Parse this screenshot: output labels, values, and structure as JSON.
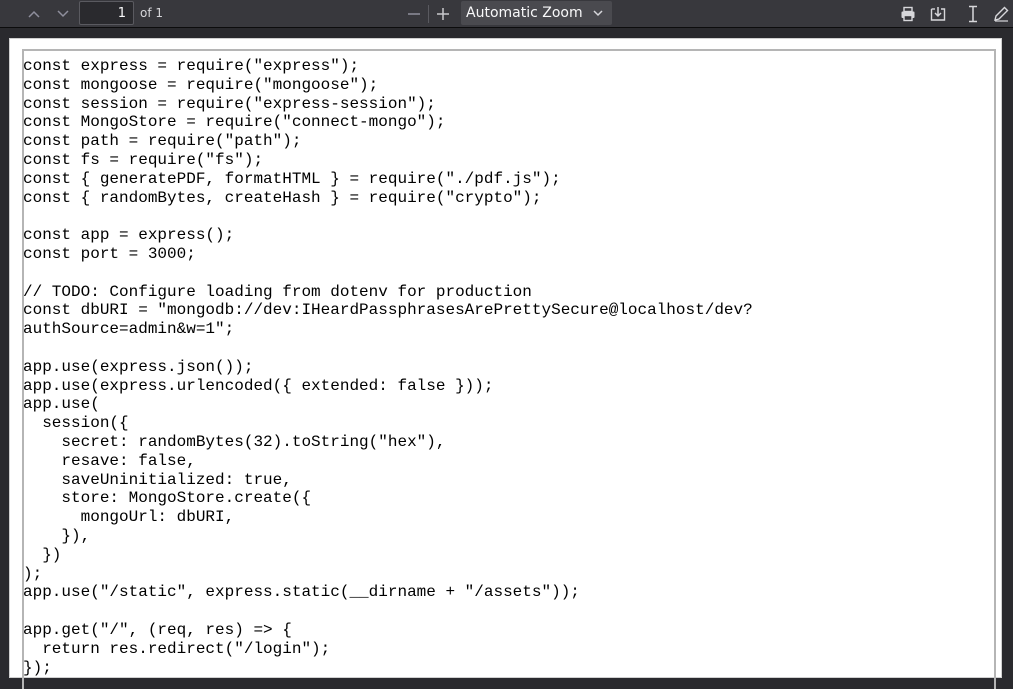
{
  "toolbar": {
    "page_number": "1",
    "page_count": "of 1",
    "zoom_value": "Automatic Zoom"
  },
  "icons": {
    "previous_page": "chevron-up-icon",
    "next_page": "chevron-down-icon",
    "zoom_out": "minus-icon",
    "zoom_in": "plus-icon",
    "zoom_dropdown": "chevron-down-icon",
    "print": "printer-icon",
    "save": "download-icon",
    "text_select": "text-cursor-icon",
    "draw": "pencil-icon"
  },
  "colors": {
    "toolbar_bg": "#38383d",
    "viewer_bg": "#2a2a2e",
    "page_bg": "#ffffff"
  },
  "document": {
    "lines": [
      "const express = require(\"express\");",
      "const mongoose = require(\"mongoose\");",
      "const session = require(\"express-session\");",
      "const MongoStore = require(\"connect-mongo\");",
      "const path = require(\"path\");",
      "const fs = require(\"fs\");",
      "const { generatePDF, formatHTML } = require(\"./pdf.js\");",
      "const { randomBytes, createHash } = require(\"crypto\");",
      "",
      "const app = express();",
      "const port = 3000;",
      "",
      "// TODO: Configure loading from dotenv for production",
      "const dbURI = \"mongodb://dev:IHeardPassphrasesArePrettySecure@localhost/dev?",
      "authSource=admin&w=1\";",
      "",
      "app.use(express.json());",
      "app.use(express.urlencoded({ extended: false }));",
      "app.use(",
      "  session({",
      "    secret: randomBytes(32).toString(\"hex\"),",
      "    resave: false,",
      "    saveUninitialized: true,",
      "    store: MongoStore.create({",
      "      mongoUrl: dbURI,",
      "    }),",
      "  })",
      ");",
      "app.use(\"/static\", express.static(__dirname + \"/assets\"));",
      "",
      "app.get(\"/\", (req, res) => {",
      "  return res.redirect(\"/login\");",
      "});"
    ]
  }
}
